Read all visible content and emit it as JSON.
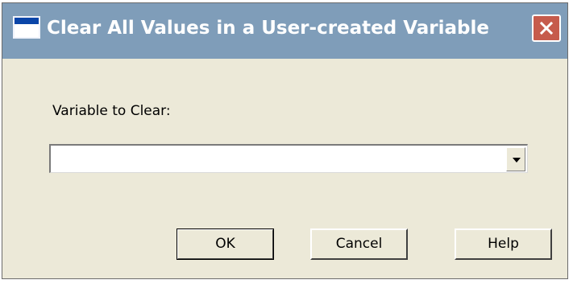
{
  "window": {
    "title": "Clear All Values in a User-created Variable",
    "close_label": "×",
    "icon": "window-icon"
  },
  "form": {
    "variable_label": "Variable to Clear:",
    "variable_value": "",
    "dropdown_arrow": "▼"
  },
  "buttons": {
    "ok_label": "OK",
    "cancel_label": "Cancel",
    "help_label": "Help"
  },
  "colors": {
    "titlebar": "#7f9db9",
    "background": "#ece9d8",
    "close": "#c65b4c"
  }
}
